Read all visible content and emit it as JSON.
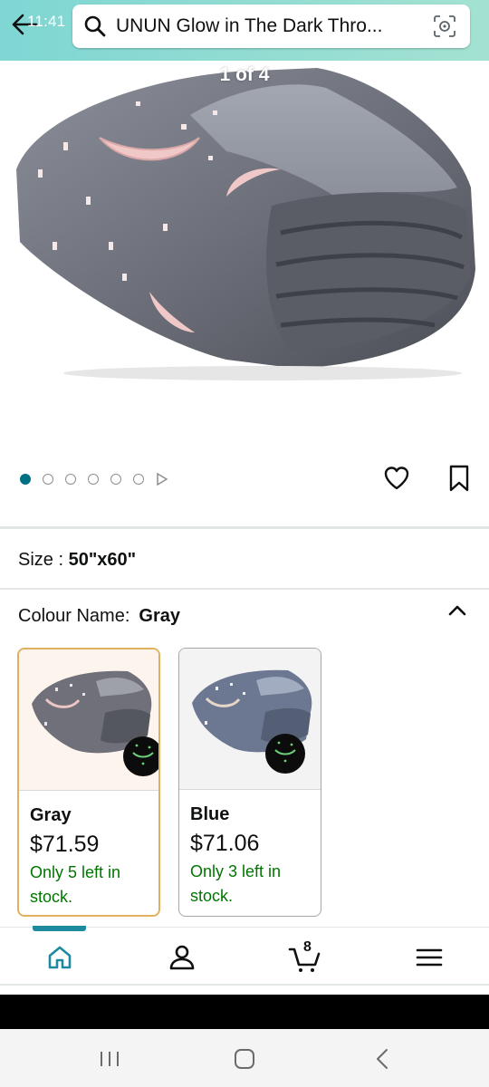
{
  "status": {
    "time": "11:41"
  },
  "search": {
    "query": "UNUN Glow in The Dark Thro..."
  },
  "gallery": {
    "counter": "1 of 4",
    "dot_count": 6,
    "active_index": 0
  },
  "product": {
    "size_label": "Size : ",
    "size_value": "50\"x60\"",
    "colour_label": "Colour Name:",
    "colour_value": "Gray"
  },
  "swatches": [
    {
      "name": "Gray",
      "price": "$71.59",
      "stock": "Only 5 left in stock.",
      "selected": true
    },
    {
      "name": "Blue",
      "price": "$71.06",
      "stock": "Only 3 left in stock.",
      "selected": false
    }
  ],
  "bottom_nav": {
    "cart_count": "8"
  },
  "colors": {
    "accent": "#007185",
    "header_start": "#7fd6d3",
    "header_end": "#a3e2d2",
    "stock_green": "#007600",
    "selected_border": "#e0b15e"
  },
  "icons": [
    "back-arrow-icon",
    "search-icon",
    "camera-lens-icon",
    "heart-icon",
    "bookmark-icon",
    "chevron-up-icon",
    "home-icon",
    "account-icon",
    "cart-icon",
    "menu-icon",
    "recent-apps-icon",
    "home-circle-icon",
    "back-icon"
  ]
}
